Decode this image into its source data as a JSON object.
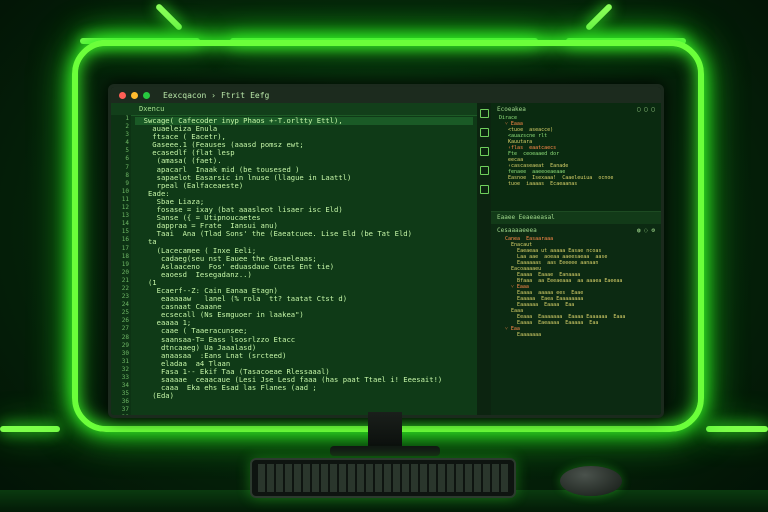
{
  "window": {
    "title_items": [
      "Eexcqacon ›",
      "Ftrit",
      "Eefg"
    ],
    "tab_label": "Dxencu"
  },
  "editor": {
    "line_numbers": [
      "1",
      "2",
      "3",
      "4",
      "5",
      "6",
      "7",
      "8",
      "9",
      "10",
      "11",
      "12",
      "13",
      "14",
      "15",
      "16",
      "17",
      "18",
      "19",
      "20",
      "21",
      "22",
      "23",
      "24",
      "25",
      "26",
      "27",
      "28",
      "29",
      "30",
      "31",
      "32",
      "33",
      "34",
      "35",
      "36",
      "37",
      "38",
      "39"
    ],
    "lines": [
      "  Swcage( Cafecoder inyp Phaos +-T.orltty Ettl),",
      "    auaeleiza Enula",
      "    ftsace ( Eacetr),",
      "    Gaseee.1 (Feauses (aaasd pomsz ewt;",
      "    ecasedlf (flat lesp",
      "     (amasa( (faet).",
      "     apacarl  Inaak mid (be tousesed )",
      "     sapaelot Easarsic in lnuse (llague in Laattl)",
      "     rpeal (Ealfaceaeste)",
      "   Eade:",
      "     Sbae Liaza;",
      "     fosase = ixay (bat aaasleot lisaer isc Eld)",
      "     Sanse ({ = Utipnoucaetes",
      "     dappraa = Frate  Iansui anu)",
      "     Taai  Ana (Tlad Sons' the (Eaeatcuee. Lise Eld (be Tat Eld)",
      "   ta",
      "     (Lacecamee ( Inxe Eeli;",
      "      cadaeg(seu nst Eauee the Gasaeleaas;",
      "      Aslaaceno  Fos' eduasdaue Cutes Ent tie)",
      "      eaoesd  Iesegadanz..)",
      "   (1",
      "     Ecaerf--Z: Cain Eanaa Etagn)",
      "      eaaaaaw   lanel (% rola  tt? taatat Ctst d)",
      "      casnaat Caaane",
      "      ecsecall (Ns Esmguoer in laakea\")",
      "     eaaaa 1;",
      "      caae ( Taaeracunsee;",
      "      saansaa-T= Eass lsosrlzzo Etacc",
      "      dtncaaeg) Ua Jaaalasd)",
      "      anaasaa  :Eans Lnat (srcteed)",
      "      eladaa  a4 Tlaan",
      "      Fasa 1-- Ekif Taa (Tasacoeae Rlessaaal)",
      "      saaaae  ceaacaue (Lesi Jse Lesd faaa (has paat Ttael i! Eeesait!)",
      "      caaa  Eka ehs Esad las Flanes (aad ;",
      "    (Eda)",
      "",
      "",
      "",
      ""
    ]
  },
  "panes": {
    "top_header": "Ecoeakea",
    "top_lines": [
      "Dirace",
      "  ˅ Eaaa",
      "   <tuoe  aseacce)",
      "   <auazscne rlt",
      "   Kauutara",
      "   ‹flas  eaatcaecs",
      "   Fte  ceoeaaed dor",
      "   eecaa",
      "   ‹cascaseaeat  Eanade",
      "   fenaee  aaeeoeaeaae",
      "   Easnoe  Isexaaa!  Caaeleuiua  ocnoe",
      "   tuoe  iaaaas  Ecaeaanas"
    ],
    "tab2_label": "Eaaee Eeaeaeasal",
    "bottom_header": "Cesaaaaeeea",
    "bottom_lines": [
      "  Canea  Easaaraaa",
      "    Enacaut",
      "      Eaeaeaa ut aaaaa Easae ncoas",
      "      Laa aae  aoeaa aaeesaeaa  aase",
      "      Eaaaaaas  aas Eeeeee aanaan",
      "    Eacoaaaaeu",
      "      Eaaaa  Eaaae  Eanaaaa",
      "      Bfaaa  aa Eeeaeaaa  aa aaaea Eaeeaa",
      "    ˅ Eaaa",
      "      Eaaaa  aaaaa ees  Eaae",
      "      Eaaaaa  Eaea Eaaaaaaaa",
      "      Eaaaaaa  Eaaaa  Eaa",
      "    Eaaa",
      "      Eeaaa  Eaaaaaaa  Eaaaa Eaaaaaa  Eaaa",
      "      Eaaaa  Eaeaaaa  Eaaaaa  Eaa",
      "  ˅ Eaa",
      "      Eaaaaaaa"
    ]
  },
  "colors": {
    "neon": "#6bff3a",
    "editor_bg": "#0f3a17",
    "code_text": "#c6f7a8"
  }
}
